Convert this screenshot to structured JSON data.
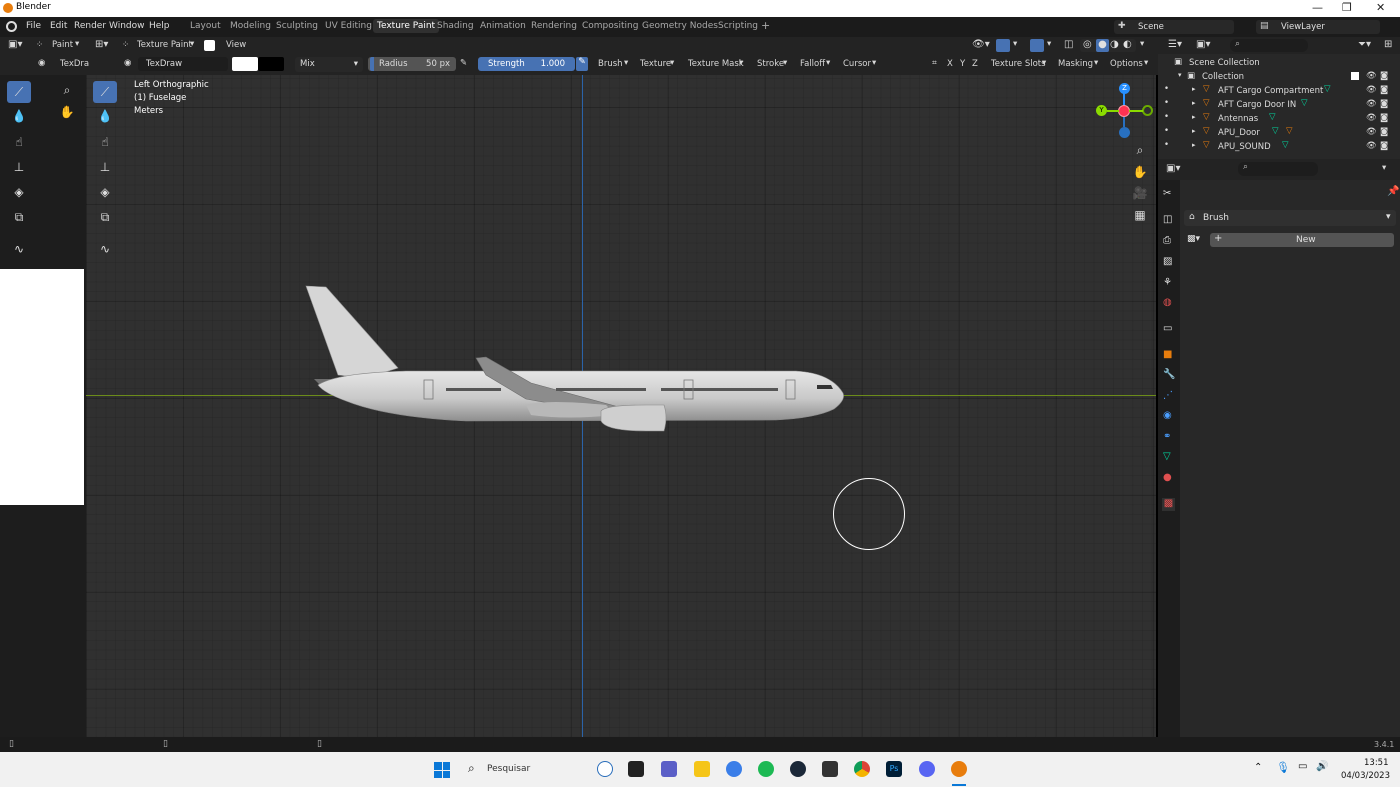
{
  "window": {
    "title": "Blender",
    "minimize": "—",
    "maximize": "❐",
    "close": "✕"
  },
  "menu": [
    "File",
    "Edit",
    "Render",
    "Window",
    "Help"
  ],
  "workspaces": [
    "Layout",
    "Modeling",
    "Sculpting",
    "UV Editing",
    "Texture Paint",
    "Shading",
    "Animation",
    "Rendering",
    "Compositing",
    "Geometry Nodes",
    "Scripting"
  ],
  "active_workspace": "Texture Paint",
  "add_workspace": "+",
  "scene": {
    "label": "Scene",
    "view_layer": "ViewLayer"
  },
  "image_editor_header": {
    "mode": "Paint",
    "view": "View"
  },
  "viewport_header": {
    "mode": "Texture Paint",
    "view": "View"
  },
  "tool_settings": {
    "brush_short": "TexDra",
    "brush_name": "TexDraw",
    "blend": "Mix",
    "radius_label": "Radius",
    "radius_value": "50 px",
    "strength_label": "Strength",
    "strength_value": "1.000",
    "menus": [
      "Brush",
      "Texture",
      "Texture Mask",
      "Stroke",
      "Falloff",
      "Cursor"
    ],
    "axes": [
      "X",
      "Y",
      "Z"
    ],
    "right_menus": [
      "Texture Slots",
      "Masking",
      "Options"
    ]
  },
  "viewport_overlay": {
    "line1": "Left Orthographic",
    "line2": "(1) Fuselage",
    "line3": "Meters"
  },
  "gizmo": {
    "z": "Z",
    "y": "Y"
  },
  "outliner": {
    "root": "Scene Collection",
    "collection": "Collection",
    "items": [
      "AFT Cargo Compartment",
      "AFT Cargo Door IN",
      "Antennas",
      "APU_Door",
      "APU_SOUND"
    ]
  },
  "properties": {
    "panel": "Brush",
    "new_button": "New"
  },
  "status": {
    "version": "3.4.1"
  },
  "taskbar": {
    "search": "Pesquisar",
    "time": "13:51",
    "date": "04/03/2023"
  },
  "colors": {
    "accent": "#4772b3",
    "x_axis": "#ff3352",
    "y_axis": "#8bdc00",
    "z_axis": "#2890ff",
    "swatch": "#ffffff"
  }
}
